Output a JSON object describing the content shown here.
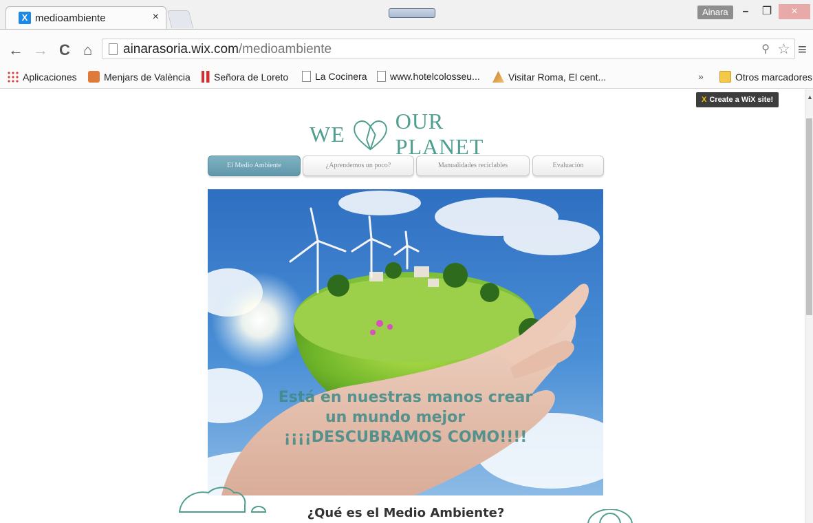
{
  "browser": {
    "tab": {
      "title": "medioambiente",
      "close": "×",
      "favicon": "X"
    },
    "user_badge": "Ainara",
    "window": {
      "minimize": "–",
      "maximize": "❐",
      "close": "×"
    },
    "nav": {
      "back": "←",
      "forward": "→",
      "reload": "C",
      "home": "⌂"
    },
    "url": {
      "host": "ainarasoria.wix.com",
      "path": "/medioambiente"
    },
    "omnibox_icons": {
      "zoom": "⚲",
      "star": "☆"
    },
    "menu": "≡",
    "bookmarks": [
      {
        "label": "Aplicaciones",
        "icon": "apps-icon"
      },
      {
        "label": "Menjars de València",
        "icon": "menjars-icon"
      },
      {
        "label": "Señora de Loreto",
        "icon": "loreto-icon"
      },
      {
        "label": "La Cocinera",
        "icon": "page-icon"
      },
      {
        "label": "www.hotelcolosseu...",
        "icon": "page-icon"
      },
      {
        "label": "Visitar Roma, El cent...",
        "icon": "roma-icon"
      }
    ],
    "bookmarks_more": "»",
    "other_bookmarks": "Otros marcadores"
  },
  "page": {
    "wix_badge": {
      "mark": "X",
      "label": "Create a WiX site!"
    },
    "logo": {
      "left": "WE",
      "right": "OUR PLANET"
    },
    "nav": [
      {
        "label": "El Medio Ambiente",
        "active": true
      },
      {
        "label": "¿Aprendemos un poco?",
        "active": false
      },
      {
        "label": "Manualidades reciclables",
        "active": false
      },
      {
        "label": "Evaluación",
        "active": false
      }
    ],
    "hero_caption": [
      "Está en nuestras manos crear",
      "un mundo mejor",
      "¡¡¡¡DESCUBRAMOS COMO!!!!"
    ],
    "section_title": "¿Qué es el Medio Ambiente?"
  },
  "colors": {
    "accent_teal": "#4f9e8f",
    "nav_active": "#6ca3b5",
    "caption": "#3e8a88"
  }
}
